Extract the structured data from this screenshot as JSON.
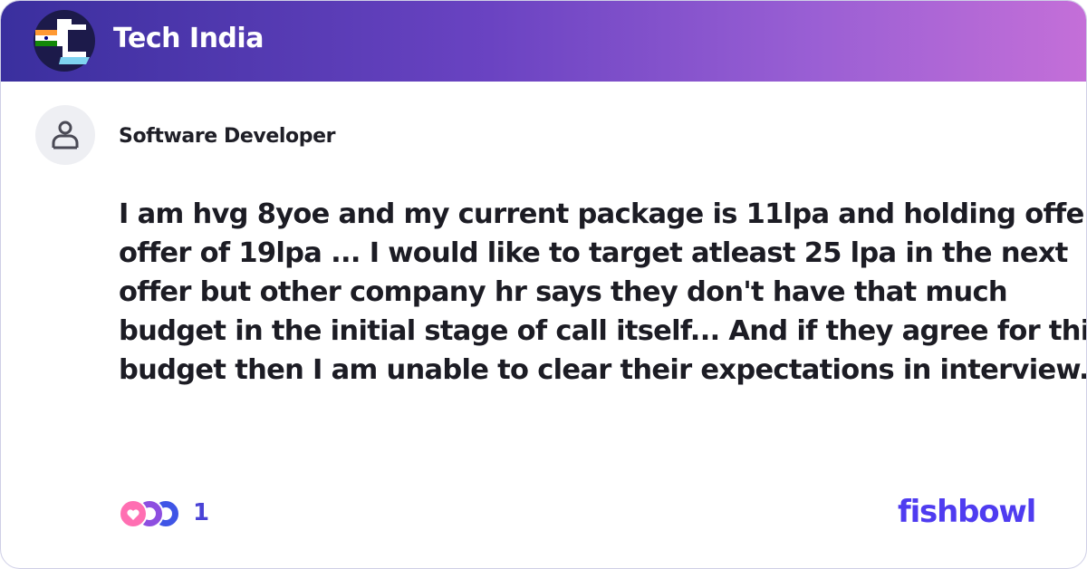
{
  "bowl": {
    "name": "Tech India",
    "logo_icon": "tech-india-logo"
  },
  "post": {
    "author_title": "Software Developer",
    "avatar_icon": "user-icon",
    "text_lines": [
      "I am hvg 8yoe and my current package is 11lpa and holding offer",
      "offer of 19lpa ... I would like to target atleast 25 lpa in the next",
      "offer but other company hr says they don't have that much",
      "budget in the initial stage of call itself... And if they agree for this",
      "budget then I am unable to clear their expectations in interview......."
    ]
  },
  "reactions": {
    "count": "1",
    "icons": [
      "heart-reaction-icon",
      "laugh-reaction-icon",
      "insightful-reaction-icon"
    ]
  },
  "brand": {
    "name": "fishbowl"
  },
  "colors": {
    "header_gradient_start": "#3a2f9e",
    "header_gradient_end": "#c46fd8",
    "brand": "#4f3cf0",
    "text": "#1c1c24"
  }
}
